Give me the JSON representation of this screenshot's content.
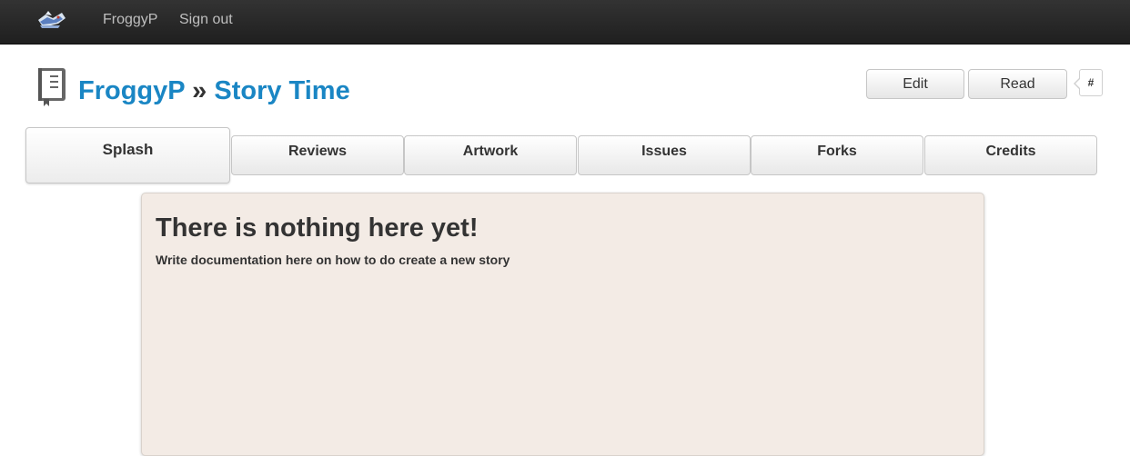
{
  "navbar": {
    "user_label": "FroggyP",
    "signout_label": "Sign out"
  },
  "header": {
    "owner": "FroggyP",
    "separator": "»",
    "story_title": "Story Time"
  },
  "actions": {
    "edit_label": "Edit",
    "read_label": "Read",
    "hash_label": "#"
  },
  "tabs": [
    {
      "label": "Splash",
      "active": true
    },
    {
      "label": "Reviews",
      "active": false
    },
    {
      "label": "Artwork",
      "active": false
    },
    {
      "label": "Issues",
      "active": false
    },
    {
      "label": "Forks",
      "active": false
    },
    {
      "label": "Credits",
      "active": false
    }
  ],
  "content": {
    "heading": "There is nothing here yet!",
    "body": "Write documentation here on how to do create a new story"
  },
  "colors": {
    "link": "#1a86c4",
    "topbar": "#2a2a2a",
    "panel_bg": "#f3ebe5"
  }
}
